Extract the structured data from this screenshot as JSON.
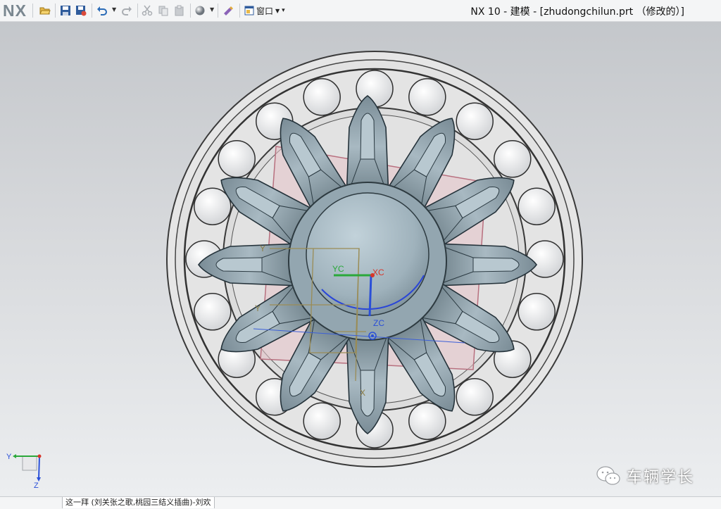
{
  "app": {
    "logo": "NX",
    "window_title": "NX 10 - 建模 - [zhudongchilun.prt （修改的）]"
  },
  "toolbar": {
    "buttons": [
      {
        "id": "open",
        "icon": "folder-open-icon"
      },
      {
        "id": "save",
        "icon": "save-icon"
      },
      {
        "id": "save-all",
        "icon": "save-all-icon"
      },
      {
        "id": "undo",
        "icon": "undo-icon"
      },
      {
        "id": "redo",
        "icon": "redo-icon"
      },
      {
        "id": "cut",
        "icon": "scissors-icon"
      },
      {
        "id": "copy",
        "icon": "copy-icon"
      },
      {
        "id": "paste",
        "icon": "paste-icon"
      },
      {
        "id": "render-style",
        "icon": "sphere-icon"
      },
      {
        "id": "edit-object",
        "icon": "brush-icon"
      }
    ],
    "window_menu": {
      "label": "窗口",
      "icon": "window-icon"
    }
  },
  "viewport": {
    "model": "bevel-gear-in-roller-bearing",
    "labels": {
      "yc": "YC",
      "xc": "XC",
      "zc": "ZC",
      "y1": "Y",
      "y2": "Y",
      "x": "X"
    },
    "triad": {
      "y": "Y",
      "z": "Z"
    },
    "colors": {
      "gear": "#8c9ea8",
      "bearing": "#e0e0e0",
      "plane": "#c88a98",
      "background": "#d3d5d8"
    }
  },
  "watermark": {
    "text": "车辆学长",
    "icon": "wechat-icon"
  },
  "statusbar": {
    "text": "这一拜 (刘关张之歌,桃园三结义插曲)-刘欢"
  }
}
